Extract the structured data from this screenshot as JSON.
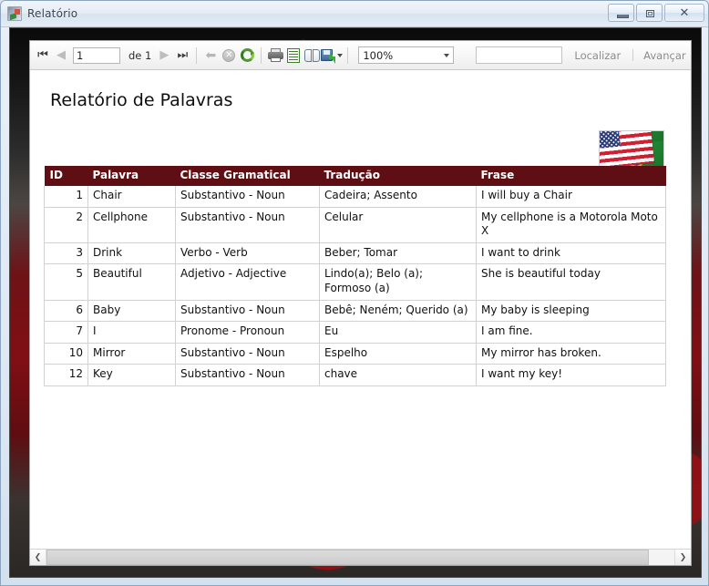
{
  "window": {
    "title": "Relatório",
    "icon": "report-image-icon",
    "buttons": {
      "minimize": "minimize-button",
      "maximize": "maximize-button",
      "close": "close-button",
      "close_glyph": "✕"
    }
  },
  "toolbar": {
    "first_page_label": "first-page",
    "prev_page_label": "previous-page",
    "page_value": "1",
    "page_total_label": "de 1",
    "next_page_label": "next-page",
    "last_page_label": "last-page",
    "back_label": "back",
    "stop_label": "stop",
    "stop_glyph": "✕",
    "refresh_label": "refresh",
    "print_label": "print",
    "page_setup_label": "page-setup",
    "print_layout_label": "print-layout",
    "export_label": "export",
    "zoom_value": "100%",
    "find_value": "",
    "find_placeholder": "",
    "find_label": "Localizar",
    "next_label": "Avançar"
  },
  "report": {
    "title": "Relatório de Palavras",
    "flag_image": "usa-brazil-flags-image",
    "table": {
      "headers": [
        "ID",
        "Palavra",
        "Classe Gramatical",
        "Tradução",
        "Frase"
      ],
      "rows": [
        {
          "id": "1",
          "palavra": "Chair",
          "classe": "Substantivo - Noun",
          "traducao": "Cadeira; Assento",
          "frase": "I will buy a Chair"
        },
        {
          "id": "2",
          "palavra": "Cellphone",
          "classe": "Substantivo - Noun",
          "traducao": "Celular",
          "frase": "My cellphone is a Motorola Moto X"
        },
        {
          "id": "3",
          "palavra": "Drink",
          "classe": "Verbo - Verb",
          "traducao": "Beber; Tomar",
          "frase": "I want to drink"
        },
        {
          "id": "5",
          "palavra": "Beautiful",
          "classe": "Adjetivo - Adjective",
          "traducao": "Lindo(a); Belo (a); Formoso (a)",
          "frase": "She is beautiful today"
        },
        {
          "id": "6",
          "palavra": "Baby",
          "classe": "Substantivo - Noun",
          "traducao": "Bebê; Neném; Querido (a)",
          "frase": "My baby is sleeping"
        },
        {
          "id": "7",
          "palavra": "I",
          "classe": "Pronome - Pronoun",
          "traducao": "Eu",
          "frase": "I am fine."
        },
        {
          "id": "10",
          "palavra": "Mirror",
          "classe": "Substantivo - Noun",
          "traducao": "Espelho",
          "frase": "My mirror has broken."
        },
        {
          "id": "12",
          "palavra": "Key",
          "classe": "Substantivo - Noun",
          "traducao": "chave",
          "frase": "I want my key!"
        }
      ]
    }
  },
  "scrollbar": {
    "left_glyph": "❮",
    "right_glyph": "❯"
  },
  "colors": {
    "header_bg": "#5f0e13",
    "header_text": "#ffffff",
    "grid_line": "#d2d2d2",
    "page_bg": "#ffffff"
  }
}
